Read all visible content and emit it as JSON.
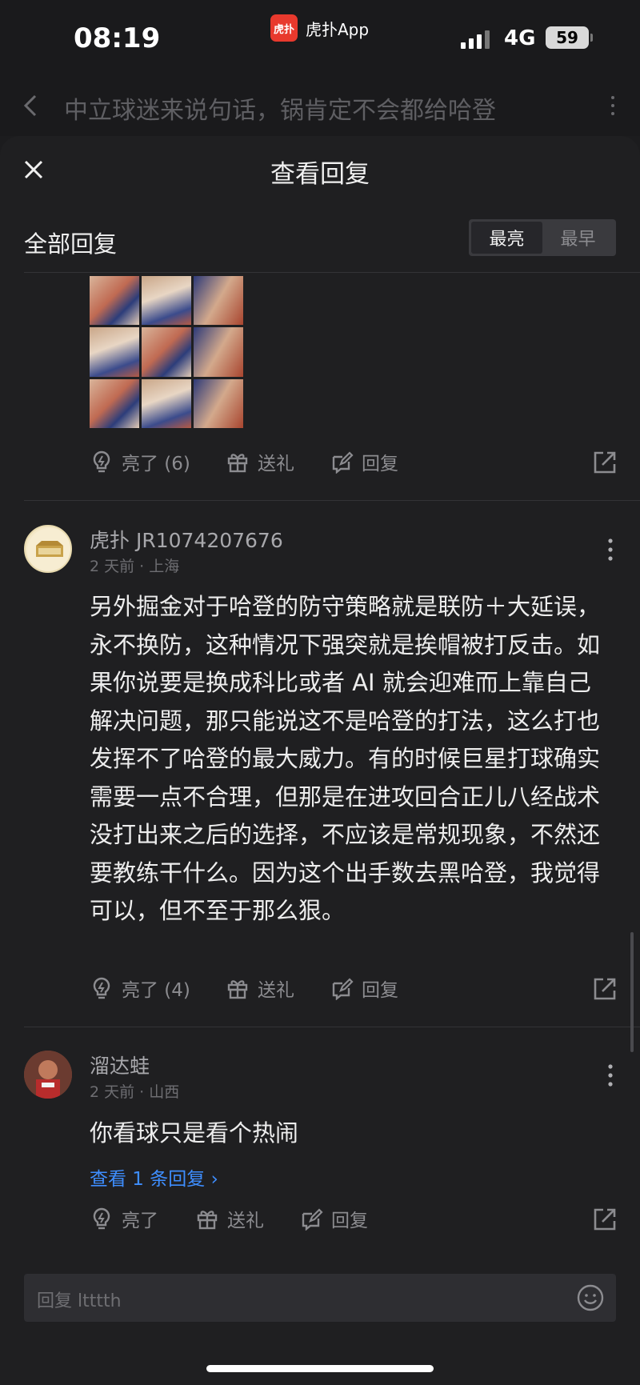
{
  "status_bar": {
    "time": "08:19",
    "app_name": "虎扑App",
    "app_logo_text": "虎扑",
    "network": "4G",
    "battery": "59"
  },
  "nav": {
    "title": "中立球迷来说句话，锅肯定不会都给哈登"
  },
  "sheet": {
    "title": "查看回复",
    "section": "全部回复",
    "sort_options": [
      "最亮",
      "最早"
    ],
    "sort_active": "最亮"
  },
  "actions_labels": {
    "gift": "送礼",
    "reply": "回复"
  },
  "first_item": {
    "light_label": "亮了 (6)"
  },
  "comments": [
    {
      "username": "虎扑 JR1074207676",
      "meta": "2 天前 · 上海",
      "body": "另外掘金对于哈登的防守策略就是联防＋大延误，永不换防，这种情况下强突就是挨帽被打反击。如果你说要是换成科比或者 AI 就会迎难而上靠自己解决问题，那只能说这不是哈登的打法，这么打也发挥不了哈登的最大威力。有的时候巨星打球确实需要一点不合理，但那是在进攻回合正儿八经战术没打出来之后的选择，不应该是常规现象，不然还要教练干什么。因为这个出手数去黑哈登，我觉得可以，但不至于那么狠。",
      "light_label": "亮了 (4)"
    },
    {
      "username": "溜达蛙",
      "meta": "2 天前 · 山西",
      "body": "你看球只是看个热闹",
      "view_replies": "查看 1 条回复 ›",
      "light_label": "亮了"
    }
  ],
  "input": {
    "placeholder": "回复 ltttth"
  },
  "colors": {
    "background": "#1f1f21",
    "accent_link": "#3e8eff",
    "logo_red": "#e8392d"
  }
}
